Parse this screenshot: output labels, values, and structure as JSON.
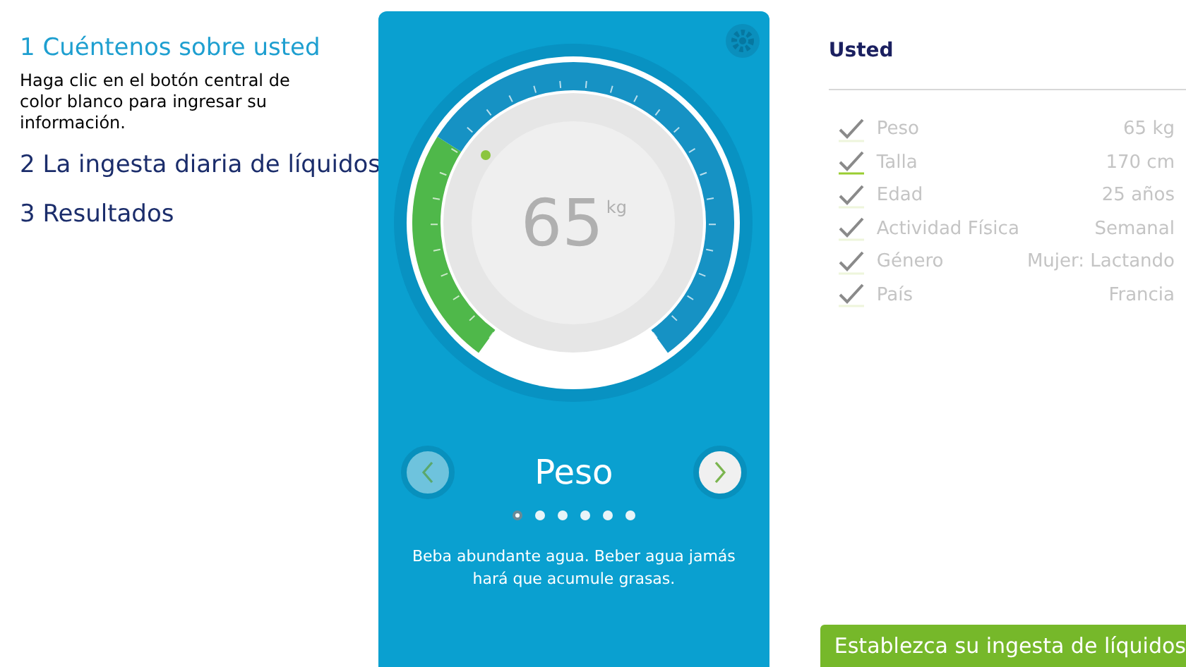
{
  "steps": [
    {
      "number": "1",
      "title": "Cuéntenos sobre usted",
      "selected": true,
      "description": "Haga clic en el botón central de color blanco para ingresar su información."
    },
    {
      "number": "2",
      "title": "La ingesta diaria de líquidos",
      "selected": false
    },
    {
      "number": "3",
      "title": "Resultados",
      "selected": false
    }
  ],
  "dial": {
    "value": "65",
    "unit": "kg",
    "label": "Peso",
    "tip": "Beba abundante agua. Beber agua jamás hará que acumule grasas.",
    "pages": [
      {
        "selected": true
      },
      {
        "selected": false
      },
      {
        "selected": false
      },
      {
        "selected": false
      },
      {
        "selected": false
      },
      {
        "selected": false
      }
    ]
  },
  "summary": {
    "title": "Usted",
    "rows": [
      {
        "label": "Peso",
        "value": "65 kg",
        "selected": false
      },
      {
        "label": "Talla",
        "value": "170 cm",
        "selected": true
      },
      {
        "label": "Edad",
        "value": "25 años",
        "selected": false
      },
      {
        "label": "Actividad Física",
        "value": "Semanal",
        "selected": false
      },
      {
        "label": "Género",
        "value": "Mujer: Lactando",
        "selected": false
      },
      {
        "label": "País",
        "value": "Francia",
        "selected": false
      }
    ]
  },
  "action_button": "Establezca su ingesta de líquidos"
}
